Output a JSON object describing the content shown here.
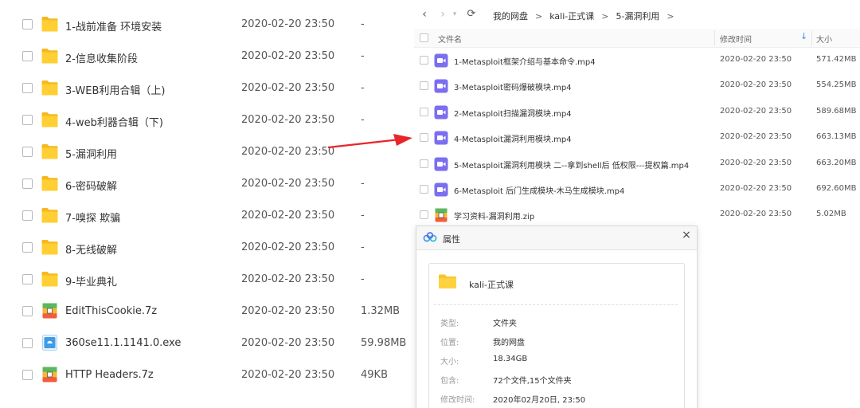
{
  "left_list": {
    "items": [
      {
        "name": "1-战前准备 环境安装",
        "date": "2020-02-20 23:50",
        "size": "-",
        "icon": "folder-icon"
      },
      {
        "name": "2-信息收集阶段",
        "date": "2020-02-20 23:50",
        "size": "-",
        "icon": "folder-icon"
      },
      {
        "name": "3-WEB利用合辑（上)",
        "date": "2020-02-20 23:50",
        "size": "-",
        "icon": "folder-icon"
      },
      {
        "name": "4-web利器合辑（下)",
        "date": "2020-02-20 23:50",
        "size": "-",
        "icon": "folder-icon"
      },
      {
        "name": "5-漏洞利用",
        "date": "2020-02-20 23:50",
        "size": "",
        "icon": "folder-icon"
      },
      {
        "name": "6-密码破解",
        "date": "2020-02-20 23:50",
        "size": "-",
        "icon": "folder-icon"
      },
      {
        "name": "7-嗅探 欺骗",
        "date": "2020-02-20 23:50",
        "size": "-",
        "icon": "folder-icon"
      },
      {
        "name": "8-无线破解",
        "date": "2020-02-20 23:50",
        "size": "-",
        "icon": "folder-icon"
      },
      {
        "name": "9-毕业典礼",
        "date": "2020-02-20 23:50",
        "size": "-",
        "icon": "folder-icon"
      },
      {
        "name": "EditThisCookie.7z",
        "date": "2020-02-20 23:50",
        "size": "1.32MB",
        "icon": "archive-icon"
      },
      {
        "name": "360se11.1.1141.0.exe",
        "date": "2020-02-20 23:50",
        "size": "59.98MB",
        "icon": "exe-icon"
      },
      {
        "name": "HTTP Headers.7z",
        "date": "2020-02-20 23:50",
        "size": "49KB",
        "icon": "archive-icon"
      }
    ]
  },
  "nav": {
    "crumbs": [
      "我的网盘",
      "kali-正式课",
      "5-漏洞利用"
    ],
    "separator": ">"
  },
  "columns": {
    "name": "文件名",
    "modified": "修改时间",
    "size": "大小"
  },
  "right_list": {
    "items": [
      {
        "name": "1-Metasploit框架介绍与基本命令.mp4",
        "date": "2020-02-20 23:50",
        "size": "571.42MB",
        "icon": "video-icon"
      },
      {
        "name": "3-Metasploit密码爆破模块.mp4",
        "date": "2020-02-20 23:50",
        "size": "554.25MB",
        "icon": "video-icon"
      },
      {
        "name": "2-Metasploit扫描漏洞模块.mp4",
        "date": "2020-02-20 23:50",
        "size": "589.68MB",
        "icon": "video-icon"
      },
      {
        "name": "4-Metasploit漏洞利用模块.mp4",
        "date": "2020-02-20 23:50",
        "size": "663.13MB",
        "icon": "video-icon"
      },
      {
        "name": "5-Metasploit漏洞利用模块 二--拿到shell后 低权限---提权篇.mp4",
        "date": "2020-02-20 23:50",
        "size": "663.20MB",
        "icon": "video-icon"
      },
      {
        "name": "6-Metasploit 后门生成模块-木马生成模块.mp4",
        "date": "2020-02-20 23:50",
        "size": "692.60MB",
        "icon": "video-icon"
      },
      {
        "name": "学习资料-漏洞利用.zip",
        "date": "2020-02-20 23:50",
        "size": "5.02MB",
        "icon": "archive-icon"
      }
    ]
  },
  "dialog": {
    "title": "属性",
    "close_label": "×",
    "folder_name": "kali-正式课",
    "props": [
      {
        "key": "类型:",
        "value": "文件夹"
      },
      {
        "key": "位置:",
        "value": "我的网盘"
      },
      {
        "key": "大小:",
        "value": "18.34GB"
      },
      {
        "key": "包含:",
        "value": "72个文件,15个文件夹"
      },
      {
        "key": "修改时间:",
        "value": "2020年02月20日, 23:50"
      }
    ]
  },
  "colors": {
    "folder": "#f8c52c",
    "video": "#7b6ef0",
    "arrow": "#e8262a",
    "accent": "#3b8ef0"
  }
}
